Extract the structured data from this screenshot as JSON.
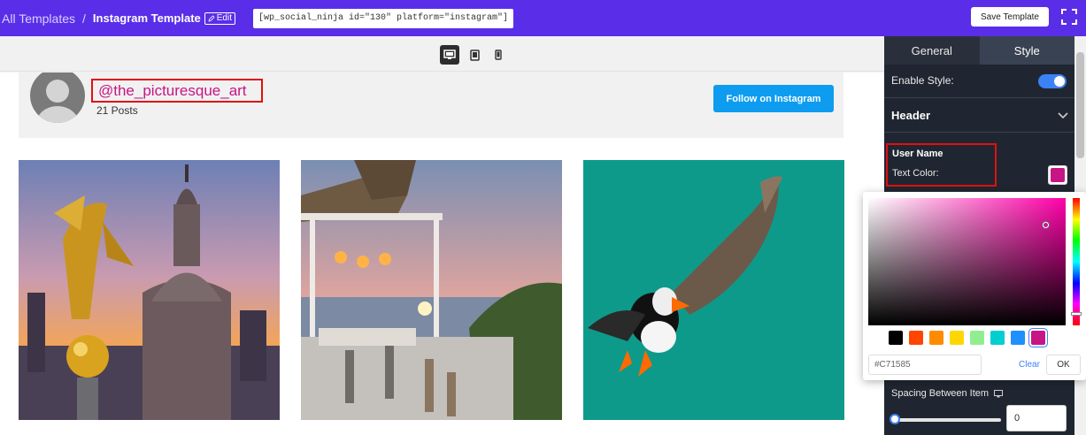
{
  "topbar": {
    "breadcrumb_all": "All Templates",
    "breadcrumb_sep": "/",
    "breadcrumb_current": "Instagram Template",
    "edit_label": "Edit",
    "shortcode": "[wp_social_ninja id=\"130\" platform=\"instagram\"]",
    "save_label": "Save Template",
    "fullscreen_icon": "fullscreen-icon"
  },
  "devices": [
    "desktop-icon",
    "tablet-icon",
    "mobile-icon"
  ],
  "preview": {
    "username": "@the_picturesque_art",
    "posts": "21 Posts",
    "follow_label": "Follow on Instagram",
    "photos": [
      "dresden-golden-angel-photo",
      "terrace-sunset-photo",
      "puffin-flying-photo"
    ]
  },
  "panel": {
    "tabs": [
      {
        "label": "General",
        "active": false
      },
      {
        "label": "Style",
        "active": true
      }
    ],
    "enable_style_label": "Enable Style:",
    "enable_style_on": true,
    "header_label": "Header",
    "user_name_label": "User Name",
    "text_color_label": "Text Color:",
    "text_color_value": "#C71585",
    "spacing_label": "Spacing Between Item",
    "spacing_value": "0"
  },
  "color_picker": {
    "hex_value": "#C71585",
    "clear_label": "Clear",
    "ok_label": "OK",
    "presets": [
      "#000000",
      "#ff4500",
      "#ff8c00",
      "#ffd700",
      "#90ee90",
      "#00ced1",
      "#1e90ff",
      "#c71585"
    ],
    "selected_preset": "#c71585"
  },
  "colors": {
    "topbar": "#5a2ee8",
    "panel": "#202631",
    "accent_blue": "#0d9cf0",
    "username_color": "#c71585"
  }
}
